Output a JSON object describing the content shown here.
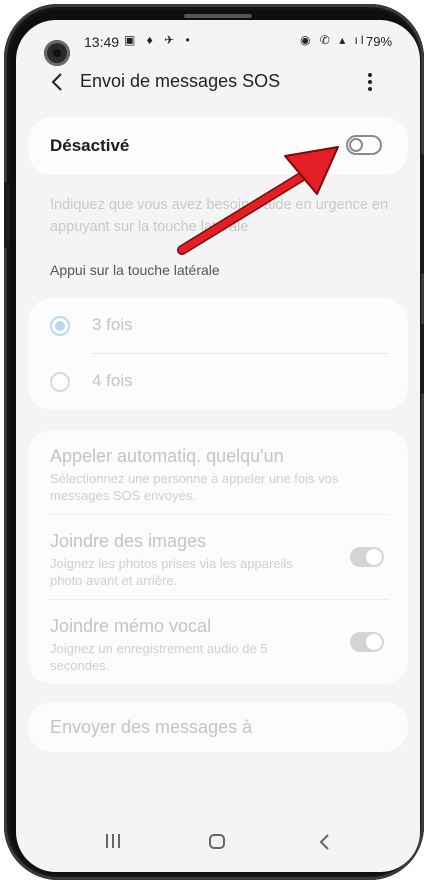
{
  "status_bar": {
    "time": "13:49",
    "left_icons": "▣ ♦ ✈ •",
    "right_icons": "◉ ✆ ▴ ıl",
    "battery": "79%"
  },
  "app_bar": {
    "title": "Envoi de messages SOS",
    "back_icon": "back-arrow-icon",
    "menu_icon": "more-vertical-icon"
  },
  "main_toggle": {
    "label": "Désactivé",
    "state": "off"
  },
  "description": "Indiquez que vous avez besoin d'aide en urgence en appuyant sur la touche latérale",
  "section_title": "Appui sur la touche latérale",
  "press_options": [
    {
      "label": "3 fois",
      "selected": true
    },
    {
      "label": "4 fois",
      "selected": false
    }
  ],
  "options": [
    {
      "title": "Appeler automatiq. quelqu'un",
      "subtitle": "Sélectionnez une personne à appeler une fois vos messages SOS envoyés.",
      "toggle": null
    },
    {
      "title": "Joindre des images",
      "subtitle": "Joignez les photos prises via les appareils photo avant et arrière.",
      "toggle": "on"
    },
    {
      "title": "Joindre mémo vocal",
      "subtitle": "Joignez un enregistrement audio de 5 secondes.",
      "toggle": "on"
    }
  ],
  "send_to": {
    "label": "Envoyer des messages à"
  },
  "colors": {
    "background": "#f4f4f4",
    "card": "#fcfcfc",
    "disabled_text": "#c4c4c4",
    "radio_selected": "#b9d6f7",
    "annotation_arrow": "#e31e24"
  }
}
